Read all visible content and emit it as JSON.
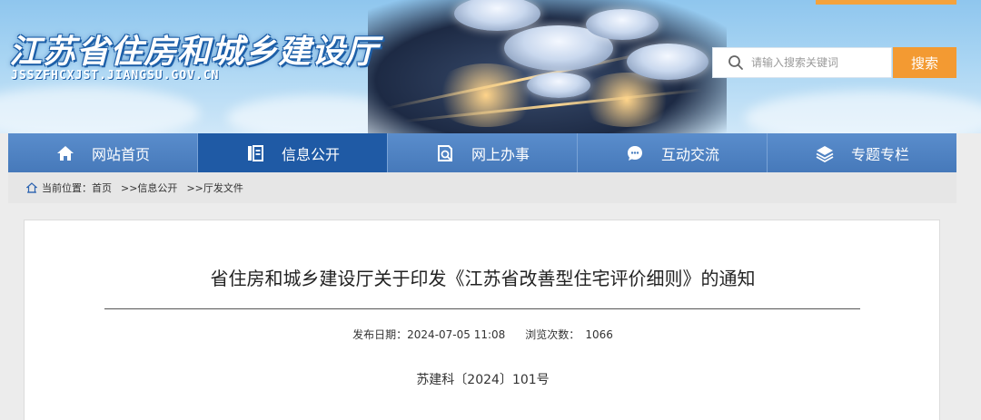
{
  "header": {
    "site_title": "江苏省住房和城乡建设厅",
    "site_url": "JSSZFHCXJST.JIANGSU.GOV.CN"
  },
  "search": {
    "placeholder": "请输入搜索关键词",
    "button_label": "搜索",
    "icon": "search-icon"
  },
  "nav": {
    "items": [
      {
        "label": "网站首页",
        "icon": "home-icon",
        "active": false
      },
      {
        "label": "信息公开",
        "icon": "document-icon",
        "active": true
      },
      {
        "label": "网上办事",
        "icon": "service-icon",
        "active": false
      },
      {
        "label": "互动交流",
        "icon": "chat-icon",
        "active": false
      },
      {
        "label": "专题专栏",
        "icon": "layers-icon",
        "active": false
      }
    ]
  },
  "breadcrumb": {
    "prefix": "当前位置：",
    "home": "首页",
    "level1": ">>信息公开",
    "level2": ">>厅发文件"
  },
  "article": {
    "title": "省住房和城乡建设厅关于印发《江苏省改善型住宅评价细则》的通知",
    "publish_label": "发布日期：",
    "publish_date": "2024-07-05 11:08",
    "views_label": "浏览次数：",
    "views": "1066",
    "doc_number": "苏建科〔2024〕101号"
  },
  "colors": {
    "nav_bg": "#4a7fc0",
    "nav_active": "#1f5aa5",
    "search_button": "#f39a32",
    "title_text": "#ffffff"
  }
}
